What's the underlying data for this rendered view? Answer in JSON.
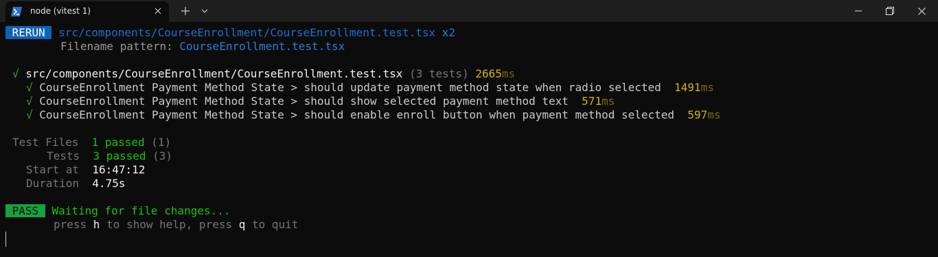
{
  "window": {
    "tab_title": "node (vitest 1)",
    "icons": {
      "tab": "powershell-icon",
      "tab_close": "close-icon",
      "new_tab": "plus-icon",
      "dropdown": "chevron-down-icon",
      "minimize": "minimize-icon",
      "maximize": "maximize-icon",
      "close": "close-icon"
    }
  },
  "colors": {
    "background": "#0c0c0c",
    "titlebar": "#1f1f1f",
    "rerun_badge": "#0e63b8",
    "pass_badge": "#16a23c",
    "green": "#16c60c",
    "yellow": "#d6b600"
  },
  "terminal": {
    "rerun": {
      "badge": " RERUN ",
      "path": "src/components/CourseEnrollment/CourseEnrollment.test.tsx",
      "count": "x2"
    },
    "filename_pattern": {
      "label": "Filename pattern: ",
      "value": "CourseEnrollment.test.tsx"
    },
    "suite": {
      "check": "√",
      "path": "src/components/CourseEnrollment/CourseEnrollment.test.tsx",
      "tests_count": "(3 tests)",
      "time": "2665",
      "unit": "ms"
    },
    "tests": [
      {
        "check": "√",
        "name": "CourseEnrollment Payment Method State > should update payment method state when radio selected",
        "time": "1491",
        "unit": "ms"
      },
      {
        "check": "√",
        "name": "CourseEnrollment Payment Method State > should show selected payment method text",
        "time": "571",
        "unit": "ms"
      },
      {
        "check": "√",
        "name": "CourseEnrollment Payment Method State > should enable enroll button when payment method selected",
        "time": "597",
        "unit": "ms"
      }
    ],
    "summary": {
      "test_files": {
        "label": "Test Files",
        "passed": "1 passed",
        "total": "(1)"
      },
      "tests": {
        "label": "Tests",
        "passed": "3 passed",
        "total": "(3)"
      },
      "start_at": {
        "label": "Start at",
        "value": "16:47:12"
      },
      "duration": {
        "label": "Duration",
        "value": "4.75s"
      }
    },
    "pass": {
      "badge": " PASS ",
      "message": "Waiting for file changes...",
      "help_press1": "press ",
      "help_key1": "h",
      "help_mid": " to show help, press ",
      "help_key2": "q",
      "help_end": " to quit"
    }
  }
}
